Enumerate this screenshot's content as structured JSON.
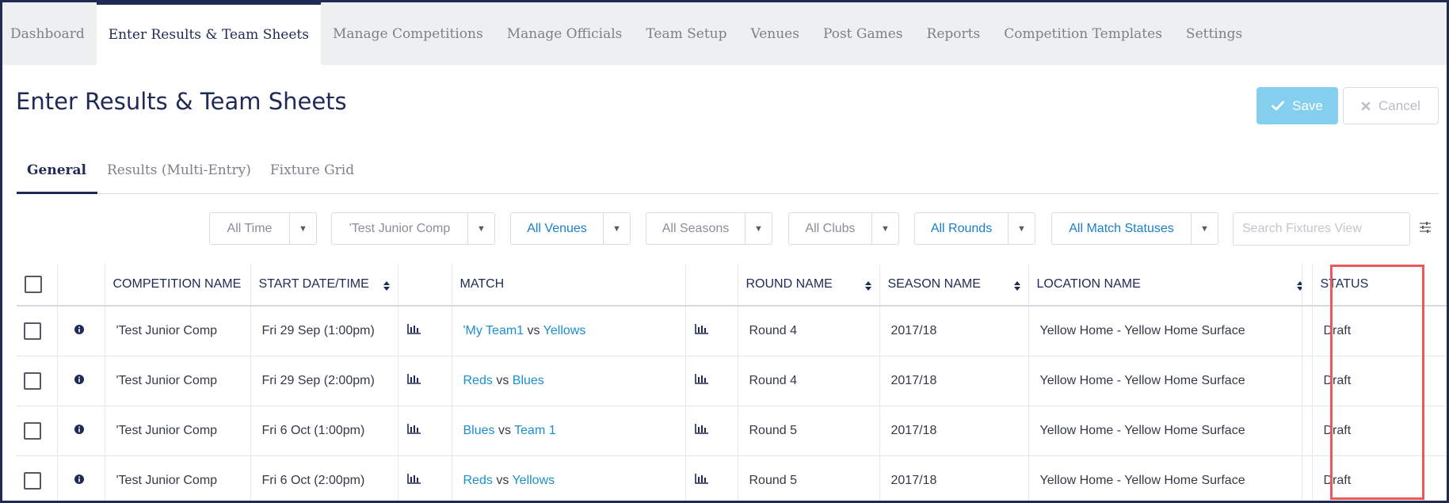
{
  "nav": {
    "items": [
      {
        "label": "Dashboard"
      },
      {
        "label": "Enter Results & Team Sheets",
        "active": true
      },
      {
        "label": "Manage Competitions"
      },
      {
        "label": "Manage Officials"
      },
      {
        "label": "Team Setup"
      },
      {
        "label": "Venues"
      },
      {
        "label": "Post Games"
      },
      {
        "label": "Reports"
      },
      {
        "label": "Competition Templates"
      },
      {
        "label": "Settings"
      }
    ]
  },
  "header": {
    "title": "Enter Results & Team Sheets",
    "save_label": "Save",
    "cancel_label": "Cancel"
  },
  "tabs": [
    {
      "label": "General",
      "active": true
    },
    {
      "label": "Results (Multi-Entry)"
    },
    {
      "label": "Fixture Grid"
    }
  ],
  "filters": [
    {
      "label": "All Time"
    },
    {
      "label": "'Test Junior Comp"
    },
    {
      "label": "All Venues"
    },
    {
      "label": "All Seasons"
    },
    {
      "label": "All Clubs"
    },
    {
      "label": "All Rounds"
    },
    {
      "label": "All Match Statuses"
    }
  ],
  "search": {
    "placeholder": "Search Fixtures View"
  },
  "table": {
    "columns": {
      "competition": "COMPETITION NAME",
      "start": "START DATE/TIME",
      "match": "MATCH",
      "round": "ROUND NAME",
      "season": "SEASON NAME",
      "location": "LOCATION NAME",
      "status": "STATUS"
    },
    "rows": [
      {
        "competition": "'Test Junior Comp",
        "start": "Fri 29 Sep (1:00pm)",
        "home": "'My Team1",
        "vs": "vs",
        "away": "Yellows",
        "round": "Round 4",
        "season": "2017/18",
        "location": "Yellow Home - Yellow Home Surface",
        "status": "Draft"
      },
      {
        "competition": "'Test Junior Comp",
        "start": "Fri 29 Sep (2:00pm)",
        "home": "Reds",
        "vs": "vs",
        "away": "Blues",
        "round": "Round 4",
        "season": "2017/18",
        "location": "Yellow Home - Yellow Home Surface",
        "status": "Draft"
      },
      {
        "competition": "'Test Junior Comp",
        "start": "Fri 6 Oct (1:00pm)",
        "home": "Blues",
        "vs": "vs",
        "away": "Team 1",
        "round": "Round 5",
        "season": "2017/18",
        "location": "Yellow Home - Yellow Home Surface",
        "status": "Draft"
      },
      {
        "competition": "'Test Junior Comp",
        "start": "Fri 6 Oct (2:00pm)",
        "home": "Reds",
        "vs": "vs",
        "away": "Yellows",
        "round": "Round 5",
        "season": "2017/18",
        "location": "Yellow Home - Yellow Home Surface",
        "status": "Draft"
      }
    ]
  },
  "colors": {
    "navy": "#1f2a55",
    "link": "#1a8fd0",
    "save_bg": "#85cfee",
    "highlight": "#e85a5a"
  }
}
